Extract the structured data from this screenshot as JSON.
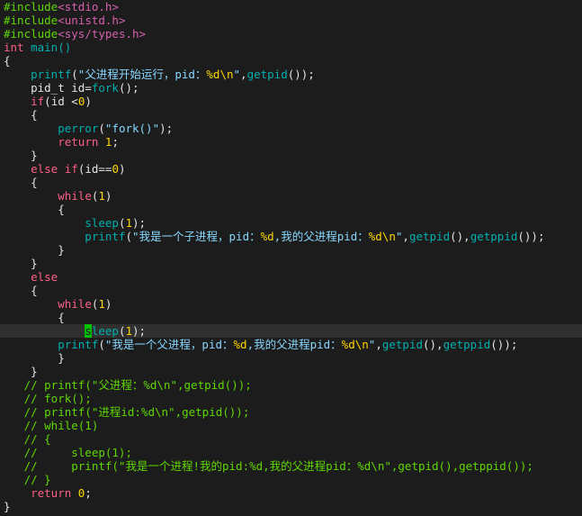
{
  "editor": {
    "background": "#1c1c1c",
    "cursor_color": "#00c000",
    "current_line": 24,
    "colors": {
      "preproc": "#5fd700",
      "header": "#d75faf",
      "type": "#ff5f87",
      "plain": "#e4e4e4",
      "string": "#87d7ff",
      "format": "#ffd700",
      "func": "#00afaf",
      "keyword": "#ff5f87",
      "number": "#ffd700",
      "comment": "#5fd700"
    },
    "lines": [
      [
        {
          "t": "#include",
          "c": "preproc"
        },
        {
          "t": "<stdio.h>",
          "c": "header"
        }
      ],
      [
        {
          "t": "#include",
          "c": "preproc"
        },
        {
          "t": "<unistd.h>",
          "c": "header"
        }
      ],
      [
        {
          "t": "#include",
          "c": "preproc"
        },
        {
          "t": "<sys/types.h>",
          "c": "header"
        }
      ],
      [
        {
          "t": "int",
          "c": "type"
        },
        {
          "t": " main()",
          "c": "func"
        }
      ],
      [
        {
          "t": "{",
          "c": "plain"
        }
      ],
      [
        {
          "t": "    printf",
          "c": "func"
        },
        {
          "t": "(",
          "c": "plain"
        },
        {
          "t": "\"父进程开始运行，pid：",
          "c": "string"
        },
        {
          "t": "%d\\n",
          "c": "format"
        },
        {
          "t": "\"",
          "c": "string"
        },
        {
          "t": ",",
          "c": "plain"
        },
        {
          "t": "getpid",
          "c": "func"
        },
        {
          "t": "());",
          "c": "plain"
        }
      ],
      [
        {
          "t": "    pid_t id=",
          "c": "plain"
        },
        {
          "t": "fork",
          "c": "func"
        },
        {
          "t": "();",
          "c": "plain"
        }
      ],
      [
        {
          "t": "    ",
          "c": "plain"
        },
        {
          "t": "if",
          "c": "keyword"
        },
        {
          "t": "(id <",
          "c": "plain"
        },
        {
          "t": "0",
          "c": "number"
        },
        {
          "t": ")",
          "c": "plain"
        }
      ],
      [
        {
          "t": "    {",
          "c": "plain"
        }
      ],
      [
        {
          "t": "        perror",
          "c": "func"
        },
        {
          "t": "(",
          "c": "plain"
        },
        {
          "t": "\"fork()\"",
          "c": "string"
        },
        {
          "t": ");",
          "c": "plain"
        }
      ],
      [
        {
          "t": "        ",
          "c": "plain"
        },
        {
          "t": "return",
          "c": "keyword"
        },
        {
          "t": " ",
          "c": "plain"
        },
        {
          "t": "1",
          "c": "number"
        },
        {
          "t": ";",
          "c": "plain"
        }
      ],
      [
        {
          "t": "    }",
          "c": "plain"
        }
      ],
      [
        {
          "t": "    ",
          "c": "plain"
        },
        {
          "t": "else",
          "c": "keyword"
        },
        {
          "t": " ",
          "c": "plain"
        },
        {
          "t": "if",
          "c": "keyword"
        },
        {
          "t": "(id==",
          "c": "plain"
        },
        {
          "t": "0",
          "c": "number"
        },
        {
          "t": ")",
          "c": "plain"
        }
      ],
      [
        {
          "t": "    {",
          "c": "plain"
        }
      ],
      [
        {
          "t": "        ",
          "c": "plain"
        },
        {
          "t": "while",
          "c": "keyword"
        },
        {
          "t": "(",
          "c": "plain"
        },
        {
          "t": "1",
          "c": "number"
        },
        {
          "t": ")",
          "c": "plain"
        }
      ],
      [
        {
          "t": "        {",
          "c": "plain"
        }
      ],
      [
        {
          "t": "            sleep",
          "c": "func"
        },
        {
          "t": "(",
          "c": "plain"
        },
        {
          "t": "1",
          "c": "number"
        },
        {
          "t": ");",
          "c": "plain"
        }
      ],
      [
        {
          "t": "            printf",
          "c": "func"
        },
        {
          "t": "(",
          "c": "plain"
        },
        {
          "t": "\"我是一个子进程，pid：",
          "c": "string"
        },
        {
          "t": "%d",
          "c": "format"
        },
        {
          "t": ",我的父进程pid：",
          "c": "string"
        },
        {
          "t": "%d\\n",
          "c": "format"
        },
        {
          "t": "\"",
          "c": "string"
        },
        {
          "t": ",",
          "c": "plain"
        },
        {
          "t": "getpid",
          "c": "func"
        },
        {
          "t": "(),",
          "c": "plain"
        },
        {
          "t": "getppid",
          "c": "func"
        },
        {
          "t": "());",
          "c": "plain"
        }
      ],
      [
        {
          "t": "        }",
          "c": "plain"
        }
      ],
      [
        {
          "t": "    }",
          "c": "plain"
        }
      ],
      [
        {
          "t": "    ",
          "c": "plain"
        },
        {
          "t": "else",
          "c": "keyword"
        }
      ],
      [
        {
          "t": "    {",
          "c": "plain"
        }
      ],
      [
        {
          "t": "        ",
          "c": "plain"
        },
        {
          "t": "while",
          "c": "keyword"
        },
        {
          "t": "(",
          "c": "plain"
        },
        {
          "t": "1",
          "c": "number"
        },
        {
          "t": ")",
          "c": "plain"
        }
      ],
      [
        {
          "t": "        {",
          "c": "plain"
        }
      ],
      [
        {
          "t": "            ",
          "c": "plain"
        },
        {
          "t": "s",
          "c": "cursor"
        },
        {
          "t": "leep",
          "c": "func"
        },
        {
          "t": "(",
          "c": "plain"
        },
        {
          "t": "1",
          "c": "number"
        },
        {
          "t": ");",
          "c": "plain"
        }
      ],
      [
        {
          "t": "        printf",
          "c": "func"
        },
        {
          "t": "(",
          "c": "plain"
        },
        {
          "t": "\"我是一个父进程，pid：",
          "c": "string"
        },
        {
          "t": "%d",
          "c": "format"
        },
        {
          "t": ",我的父进程pid：",
          "c": "string"
        },
        {
          "t": "%d\\n",
          "c": "format"
        },
        {
          "t": "\"",
          "c": "string"
        },
        {
          "t": ",",
          "c": "plain"
        },
        {
          "t": "getpid",
          "c": "func"
        },
        {
          "t": "(),",
          "c": "plain"
        },
        {
          "t": "getppid",
          "c": "func"
        },
        {
          "t": "());",
          "c": "plain"
        }
      ],
      [
        {
          "t": "        }",
          "c": "plain"
        }
      ],
      [
        {
          "t": "    }",
          "c": "plain"
        }
      ],
      [
        {
          "t": "   // printf(\"父进程：%d\\n\",getpid());",
          "c": "comment"
        }
      ],
      [
        {
          "t": "   // fork();",
          "c": "comment"
        }
      ],
      [
        {
          "t": "   // printf(\"进程id:%d\\n\",getpid());",
          "c": "comment"
        }
      ],
      [
        {
          "t": "   // while(1)",
          "c": "comment"
        }
      ],
      [
        {
          "t": "   // {",
          "c": "comment"
        }
      ],
      [
        {
          "t": "   //     sleep(1);",
          "c": "comment"
        }
      ],
      [
        {
          "t": "   //     printf(\"我是一个进程!我的pid:%d,我的父进程pid：%d\\n\",getpid(),getppid());",
          "c": "comment"
        }
      ],
      [
        {
          "t": "   // }",
          "c": "comment"
        }
      ],
      [
        {
          "t": "    ",
          "c": "plain"
        },
        {
          "t": "return",
          "c": "keyword"
        },
        {
          "t": " ",
          "c": "plain"
        },
        {
          "t": "0",
          "c": "number"
        },
        {
          "t": ";",
          "c": "plain"
        }
      ],
      [
        {
          "t": "}",
          "c": "plain"
        }
      ]
    ]
  }
}
